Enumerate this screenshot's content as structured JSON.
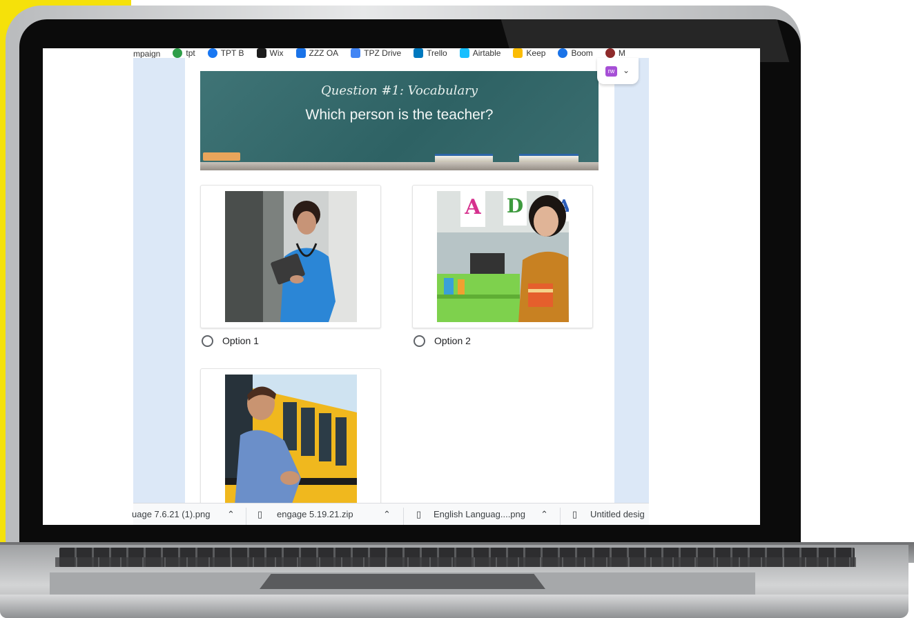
{
  "bookmarks": [
    {
      "label": "mpaign",
      "color": "#ffffff"
    },
    {
      "label": "tpt",
      "color": "#2e9e49"
    },
    {
      "label": "TPT B",
      "color": "#1877f2"
    },
    {
      "label": "Wix",
      "color": "#1c1c1c"
    },
    {
      "label": "ZZZ OA",
      "color": "#1a73e8"
    },
    {
      "label": "TPZ Drive",
      "color": "#4285f4"
    },
    {
      "label": "Trello",
      "color": "#0079bf"
    },
    {
      "label": "Airtable",
      "color": "#18bfff"
    },
    {
      "label": "Keep",
      "color": "#fbbc04"
    },
    {
      "label": "Boom",
      "color": "#1a73e8"
    },
    {
      "label": "M",
      "color": "#8e2a2a"
    }
  ],
  "question": {
    "label": "Question #1: Vocabulary",
    "text": "Which person is the teacher?"
  },
  "options": [
    {
      "label": "Option 1",
      "photo": "nurse-with-tablet"
    },
    {
      "label": "Option 2",
      "photo": "teacher-in-classroom"
    },
    {
      "label": "",
      "photo": "school-bus-driver"
    }
  ],
  "extension": {
    "badge": "rw",
    "icon": "puzzle-icon"
  },
  "downloads": [
    {
      "name": "uage 7.6.21 (1).png"
    },
    {
      "name": "engage 5.19.21.zip"
    },
    {
      "name": "English Languag....png"
    },
    {
      "name": "Untitled desig"
    }
  ],
  "colors": {
    "accent": "#f5e10a",
    "chalkboard": "#2e6264",
    "extension": "#a64fd6"
  }
}
